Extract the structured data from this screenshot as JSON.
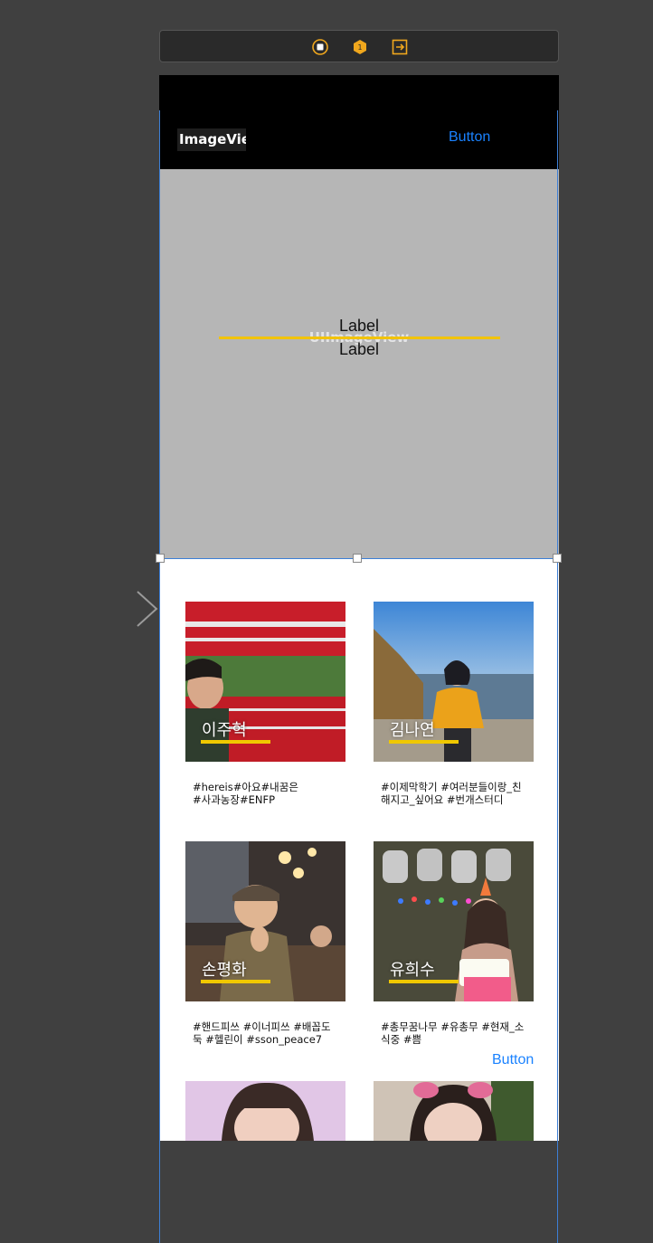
{
  "scene_dock": {
    "icons": [
      "view-controller-icon",
      "first-responder-icon",
      "exit-icon"
    ],
    "accent_color": "#f0a71d"
  },
  "header": {
    "image_label": "ImageView",
    "button_label": "Button"
  },
  "hero": {
    "placeholder_text": "UIImageView",
    "label_top": "Label",
    "label_bottom": "Label"
  },
  "cards": [
    {
      "name": "이주혁",
      "tags": "#hereis#아요#내꿈은\n#사과농장#ENFP"
    },
    {
      "name": "김나연",
      "tags": "#이제막학기 #여러분들이랑_친\n해지고_싶어요 #번개스터디"
    },
    {
      "name": "손평화",
      "tags": "#핸드피쓰 #이너피쓰 #배꼽도\n둑 #헬린이 #sson_peace7"
    },
    {
      "name": "유희수",
      "tags": "#총무꿈나무 #유총무 #현재_소\n식중 #쁨"
    }
  ],
  "grid_button_label": "Button",
  "colors": {
    "canvas": "#404040",
    "accent_yellow": "#f0c800",
    "system_blue": "#1a82ff",
    "selection_blue": "#3d7fd6"
  }
}
